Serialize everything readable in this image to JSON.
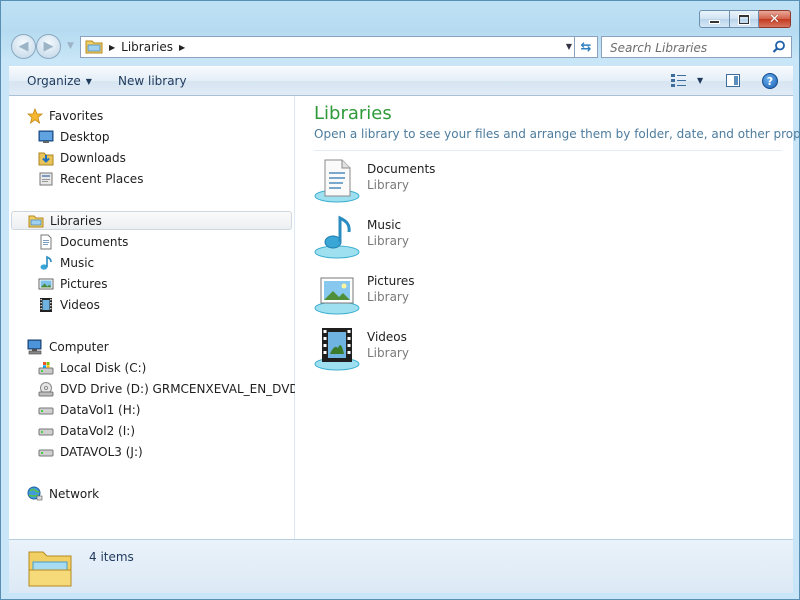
{
  "window": {
    "caption": {
      "minimize": "minimize",
      "maximize": "maximize",
      "close": "close"
    }
  },
  "address_bar": {
    "crumbs": [
      "Libraries"
    ],
    "search_placeholder": "Search Libraries"
  },
  "toolbar": {
    "organize_label": "Organize",
    "new_library_label": "New library"
  },
  "nav_pane": {
    "favorites": {
      "label": "Favorites",
      "items": [
        {
          "label": "Desktop",
          "icon": "desktop-icon"
        },
        {
          "label": "Downloads",
          "icon": "downloads-icon"
        },
        {
          "label": "Recent Places",
          "icon": "recent-places-icon"
        }
      ]
    },
    "libraries": {
      "label": "Libraries",
      "items": [
        {
          "label": "Documents",
          "icon": "documents-icon"
        },
        {
          "label": "Music",
          "icon": "music-icon"
        },
        {
          "label": "Pictures",
          "icon": "pictures-icon"
        },
        {
          "label": "Videos",
          "icon": "videos-icon"
        }
      ]
    },
    "computer": {
      "label": "Computer",
      "items": [
        {
          "label": "Local Disk (C:)",
          "icon": "local-disk-icon"
        },
        {
          "label": "DVD Drive (D:) GRMCENXEVAL_EN_DVD",
          "icon": "dvd-drive-icon"
        },
        {
          "label": "DataVol1 (H:)",
          "icon": "drive-icon"
        },
        {
          "label": "DataVol2 (I:)",
          "icon": "drive-icon"
        },
        {
          "label": "DATAVOL3 (J:)",
          "icon": "drive-icon"
        }
      ]
    },
    "network": {
      "label": "Network"
    }
  },
  "content": {
    "title": "Libraries",
    "subtitle": "Open a library to see your files and arrange them by folder, date, and other properties.",
    "libraries": [
      {
        "name": "Documents",
        "type": "Library",
        "icon": "documents-library-icon"
      },
      {
        "name": "Music",
        "type": "Library",
        "icon": "music-library-icon"
      },
      {
        "name": "Pictures",
        "type": "Library",
        "icon": "pictures-library-icon"
      },
      {
        "name": "Videos",
        "type": "Library",
        "icon": "videos-library-icon"
      }
    ]
  },
  "details_pane": {
    "item_count": "4 items"
  },
  "colors": {
    "title_green": "#2e9a3a",
    "subtitle_blue": "#4d7c9e",
    "chrome_blue": "#c8e6f7",
    "command_text": "#1e395b"
  }
}
